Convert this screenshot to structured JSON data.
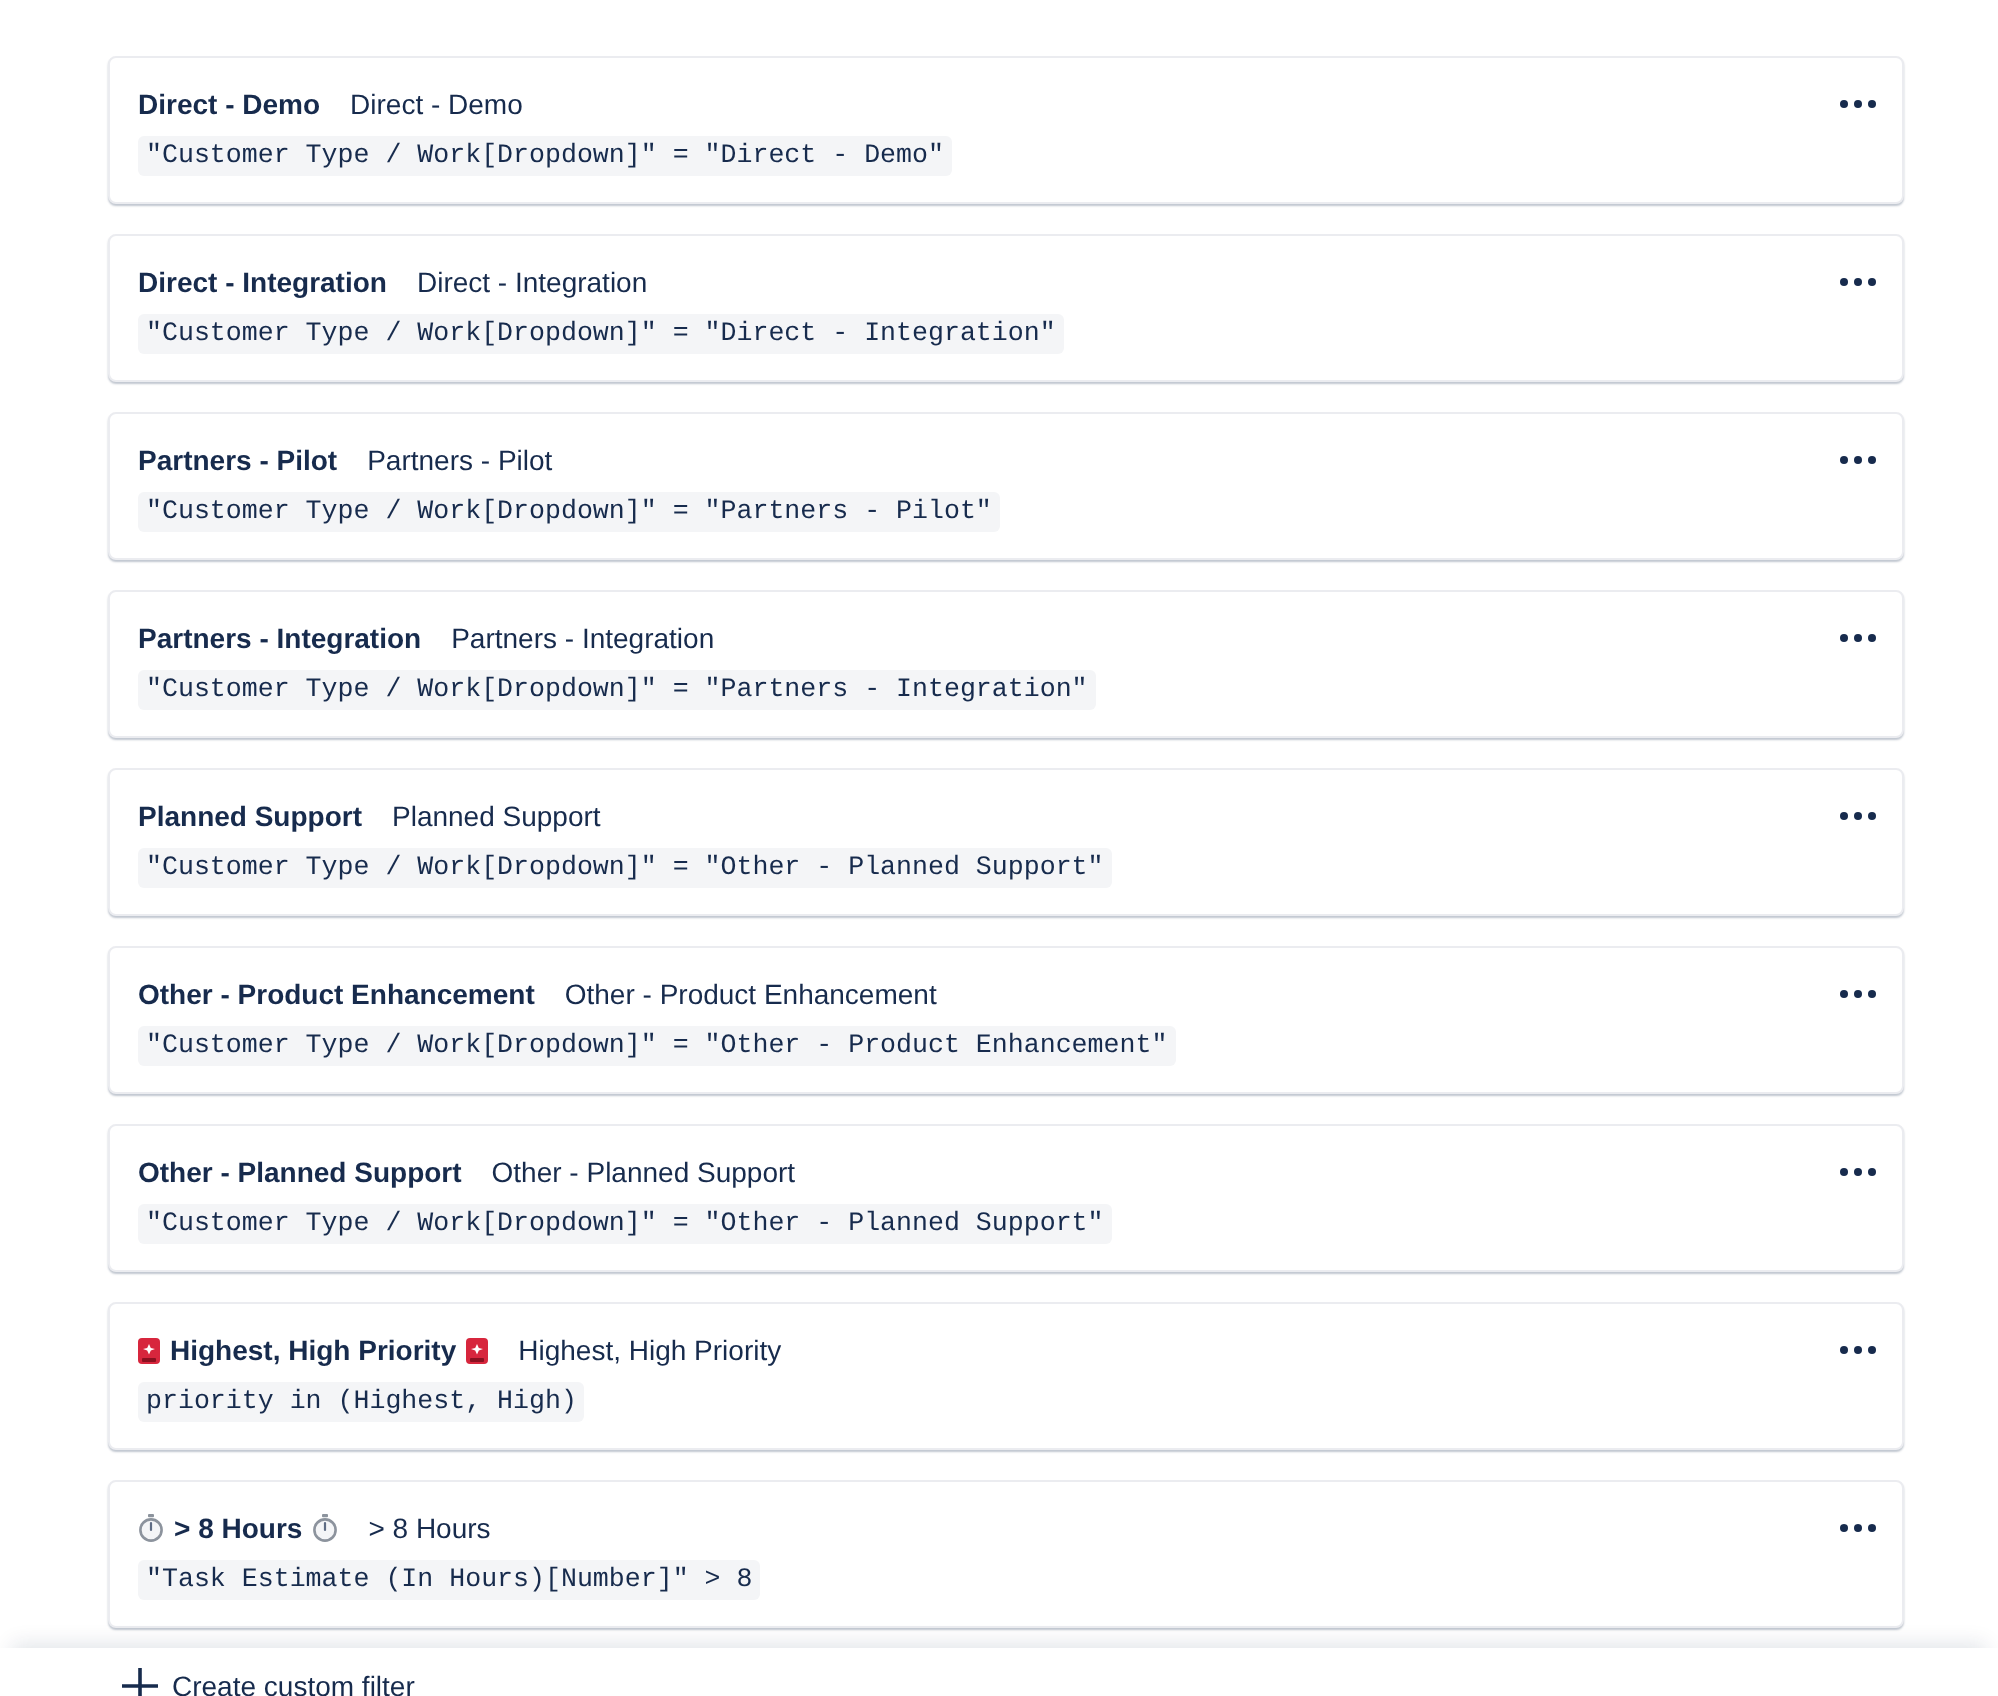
{
  "filters": [
    {
      "kind": "dropdown",
      "name": "Direct - Demo",
      "description": "Direct - Demo",
      "query": "\"Customer Type / Work[Dropdown]\" = \"Direct - Demo\""
    },
    {
      "kind": "dropdown",
      "name": "Direct - Integration",
      "description": "Direct - Integration",
      "query": "\"Customer Type / Work[Dropdown]\" = \"Direct - Integration\""
    },
    {
      "kind": "dropdown",
      "name": "Partners - Pilot",
      "description": "Partners - Pilot",
      "query": "\"Customer Type / Work[Dropdown]\" = \"Partners - Pilot\""
    },
    {
      "kind": "dropdown",
      "name": "Partners - Integration",
      "description": "Partners - Integration",
      "query": "\"Customer Type / Work[Dropdown]\" = \"Partners - Integration\""
    },
    {
      "kind": "dropdown",
      "name": "Planned Support",
      "description": "Planned Support",
      "query": "\"Customer Type / Work[Dropdown]\" = \"Other - Planned Support\""
    },
    {
      "kind": "dropdown",
      "name": "Other - Product Enhancement",
      "description": "Other - Product Enhancement",
      "query": "\"Customer Type / Work[Dropdown]\" = \"Other - Product Enhancement\""
    },
    {
      "kind": "dropdown",
      "name": "Other - Planned Support",
      "description": "Other - Planned Support",
      "query": "\"Customer Type / Work[Dropdown]\" = \"Other - Planned Support\""
    },
    {
      "kind": "priority",
      "name": "Highest, High Priority",
      "description": "Highest, High Priority",
      "query": "priority in (Highest, High)"
    },
    {
      "kind": "estimate",
      "name": "> 8 Hours",
      "description": "> 8 Hours",
      "query": "\"Task Estimate (In Hours)[Number]\" > 8"
    }
  ],
  "create_button": {
    "label": "Create custom filter"
  }
}
